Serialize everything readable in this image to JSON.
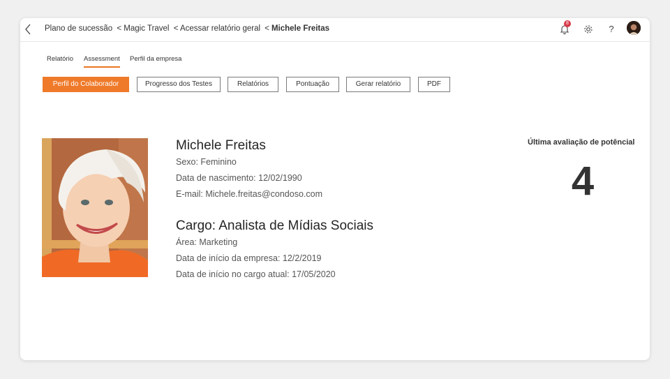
{
  "breadcrumb": {
    "items": [
      "Plano de sucessão",
      "< Magic Travel",
      "< Acessar relatório geral",
      "<",
      "Michele Freitas"
    ]
  },
  "header": {
    "notification_count": "8",
    "help_glyph": "?",
    "icons": [
      "back-arrow-icon",
      "bell-icon",
      "gear-icon",
      "help-icon",
      "user-avatar"
    ]
  },
  "tabs": [
    {
      "label": "Relatório",
      "active": false
    },
    {
      "label": "Assessment",
      "active": true
    },
    {
      "label": "Perfil da empresa",
      "active": false
    }
  ],
  "actions": [
    {
      "label": "Perfil do Colaborador",
      "primary": true
    },
    {
      "label": "Progresso dos Testes",
      "primary": false
    },
    {
      "label": "Relatórios",
      "primary": false
    },
    {
      "label": "Pontuação",
      "primary": false
    },
    {
      "label": "Gerar relatório",
      "primary": false
    },
    {
      "label": "PDF",
      "primary": false
    }
  ],
  "profile": {
    "name": "Michele Freitas",
    "sexo": "Sexo: Feminino",
    "nascimento": "Data de nascimento: 12/02/1990",
    "email": "E-mail: Michele.freitas@condoso.com",
    "cargo": "Cargo: Analista de Mídias Sociais",
    "area": "Área: Marketing",
    "inicio_empresa": "Data de início da empresa: 12/2/2019",
    "inicio_cargo": "Data de início no cargo atual: 17/05/2020"
  },
  "evaluation": {
    "label": "Última avaliação de potêncial",
    "score": "4"
  },
  "colors": {
    "accent": "#ef7a2a",
    "background": "#f0f0f0",
    "badge": "#d73a49"
  }
}
